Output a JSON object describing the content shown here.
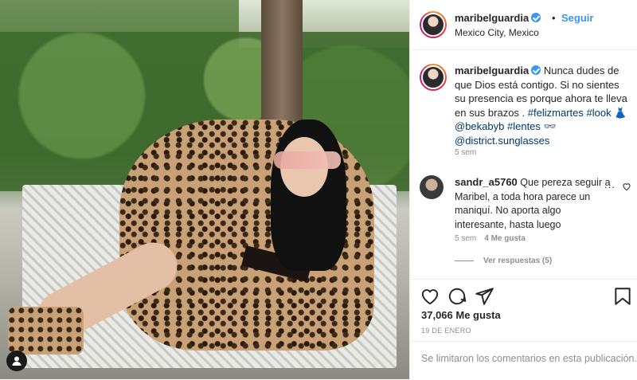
{
  "post": {
    "username": "maribelguardia",
    "follow_label": "Seguir",
    "dot": "•",
    "location": "Mexico City, Mexico"
  },
  "caption": {
    "username": "maribelguardia",
    "text_part1": "Nunca dudes de que Dios está contigo. Si no sientes su presencia es porque ahora te lleva en sus brazos . ",
    "hashtag1": "#felizmartes",
    "hashtag2": "#look",
    "emoji1": "👗",
    "mention1": "@bekabyb",
    "hashtag3": "#lentes",
    "emoji2": "👓",
    "mention2": "@district.sunglasses",
    "time": "5 sem"
  },
  "comment": {
    "username": "sandr_a5760",
    "text": "Que pereza seguir a Maribel, a toda hora parece un maniquí. No aporta algo interesante, hasta luego",
    "more": "...",
    "time": "5 sem",
    "likes": "4 Me gusta",
    "replies": "Ver respuestas (5)"
  },
  "footer": {
    "likes": "37,066 Me gusta",
    "date": "19 DE ENERO",
    "limited": "Se limitaron los comentarios en esta publicación."
  },
  "icons": [
    "heart-icon",
    "comment-icon",
    "share-icon",
    "bookmark-icon",
    "user-tag-icon",
    "verified-icon"
  ]
}
